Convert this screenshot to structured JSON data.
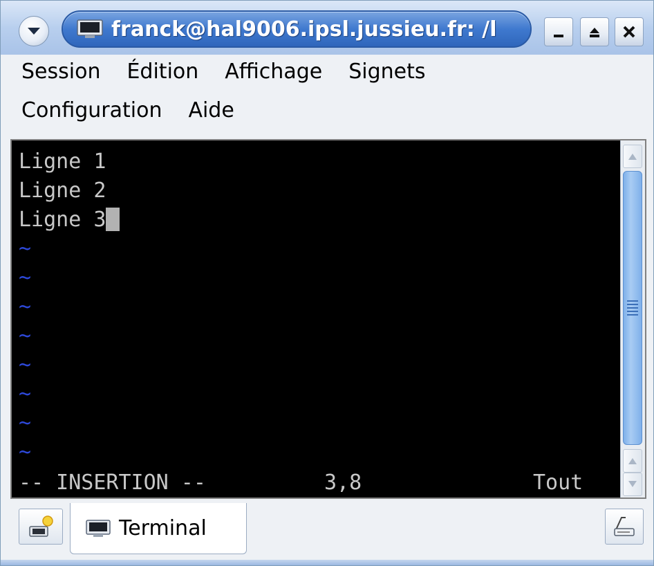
{
  "window": {
    "title": "franck@hal9006.ipsl.jussieu.fr: /l",
    "icons": {
      "menu": "window-menu-icon",
      "app": "terminal-icon",
      "minimize": "minimize-icon",
      "maximize": "maximize-icon",
      "close": "close-icon"
    }
  },
  "menubar": {
    "row1": [
      "Session",
      "Édition",
      "Affichage",
      "Signets"
    ],
    "row2": [
      "Configuration",
      "Aide"
    ]
  },
  "terminal": {
    "lines": [
      "Ligne 1",
      "Ligne 2",
      "Ligne 3"
    ],
    "empty_marker": "~",
    "status": {
      "mode": "-- INSERTION --",
      "position": "3,8",
      "scope": "Tout"
    }
  },
  "tabbar": {
    "tab_label": "Terminal",
    "new_tab_icon": "new-session-icon",
    "rename_icon": "rename-session-icon"
  },
  "colors": {
    "title_accent": "#3f79cf",
    "terminal_bg": "#000000",
    "terminal_fg": "#c8c8c8",
    "tilde": "#2d48d8"
  }
}
